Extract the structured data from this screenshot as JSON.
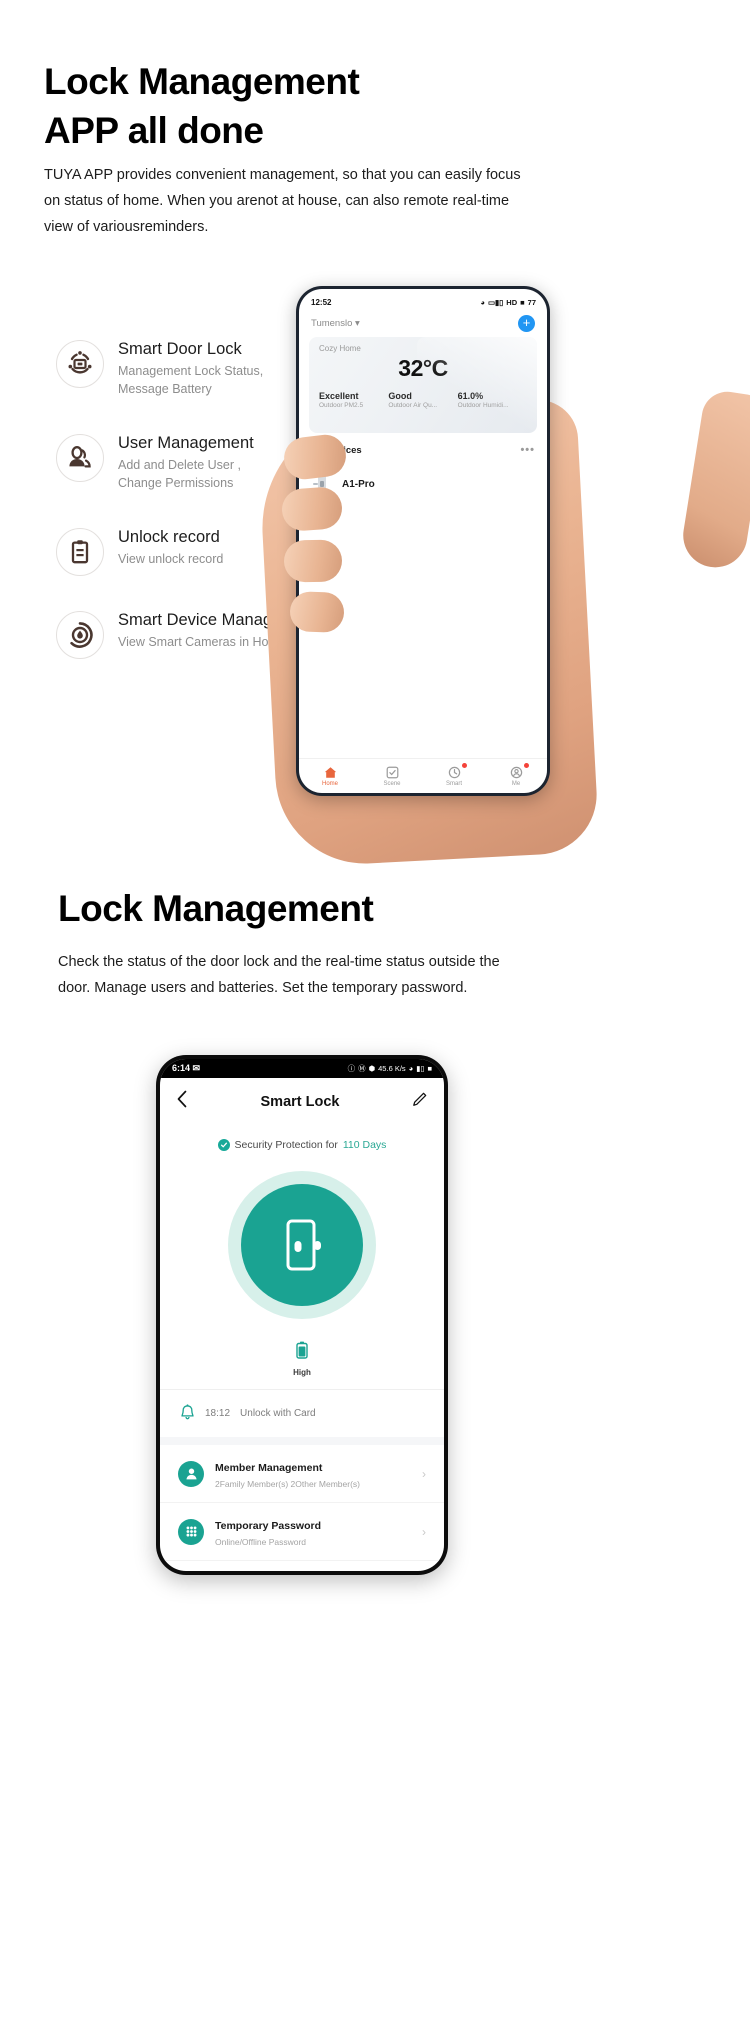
{
  "section1": {
    "heading_line1": "Lock Management",
    "heading_line2": "APP all done",
    "lead": "TUYA APP provides convenient management, so that you can easily focus on status of home. When you arenot at house, can also remote real-time view of variousreminders.",
    "features": [
      {
        "icon": "smart-door-lock-icon",
        "title": "Smart Door Lock",
        "subtitle_line1": "Management Lock Status,",
        "subtitle_line2": "Message Battery"
      },
      {
        "icon": "user-management-icon",
        "title": "User Management",
        "subtitle_line1": "Add and Delete User ,",
        "subtitle_line2": "Change Permissions"
      },
      {
        "icon": "unlock-record-icon",
        "title": "Unlock record",
        "subtitle_line1": "View unlock record",
        "subtitle_line2": ""
      },
      {
        "icon": "smart-device-management-icon",
        "title": "Smart Device Management",
        "subtitle_line1": "View Smart Cameras in Home",
        "subtitle_line2": ""
      }
    ],
    "phone": {
      "status": {
        "time": "12:52",
        "signal": "HD",
        "battery": "77"
      },
      "home_name": "Tumenslo",
      "add_button": "+",
      "weather": {
        "place": "Cozy Home",
        "temperature": "32°C",
        "metrics": [
          {
            "value": "Excellent",
            "label": "Outdoor PM2.5"
          },
          {
            "value": "Good",
            "label": "Outdoor Air Qu..."
          },
          {
            "value": "61.0%",
            "label": "Outdoor Humidi..."
          }
        ]
      },
      "devices_title": "All Devices",
      "devices_more": "•••",
      "devices": [
        {
          "name": "A1-Pro"
        }
      ],
      "nav": [
        {
          "label": "Home",
          "icon": "home-icon",
          "active": true,
          "badge": false
        },
        {
          "label": "Scene",
          "icon": "scene-icon",
          "active": false,
          "badge": false
        },
        {
          "label": "Smart",
          "icon": "smart-icon",
          "active": false,
          "badge": true
        },
        {
          "label": "Me",
          "icon": "me-icon",
          "active": false,
          "badge": true
        }
      ]
    }
  },
  "section2": {
    "heading": "Lock Management",
    "lead": "Check the status of the door lock and the real-time status outside the door. Manage users and batteries. Set the temporary password.",
    "phone": {
      "status": {
        "time": "6:14",
        "indicators": "45.6 K/s"
      },
      "back_icon": "back-chevron-icon",
      "title": "Smart Lock",
      "edit_icon": "edit-pencil-icon",
      "security_prefix": "Security Protection for",
      "security_days": "110 Days",
      "lock_button_icon": "door-lock-icon",
      "battery_label": "High",
      "record": {
        "time": "18:12",
        "text": "Unlock with Card"
      },
      "rows": [
        {
          "icon": "member-icon",
          "title": "Member Management",
          "subtitle": "2Family Member(s)  2Other Member(s)"
        },
        {
          "icon": "keypad-icon",
          "title": "Temporary Password",
          "subtitle": "Online/Offline Password"
        }
      ]
    }
  },
  "colors": {
    "accent_teal": "#1aa392",
    "accent_blue": "#2196f3",
    "accent_orange": "#e8663d",
    "icon_brown": "#4a3730"
  }
}
